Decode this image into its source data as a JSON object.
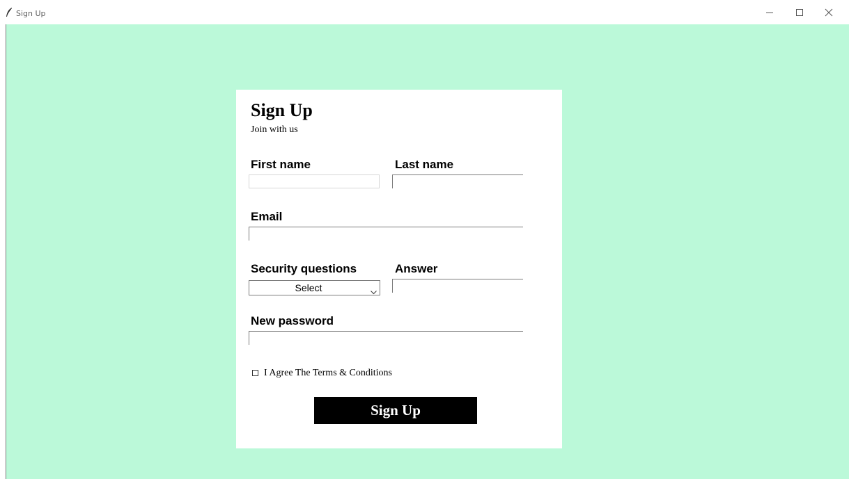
{
  "window": {
    "title": "Sign Up"
  },
  "form": {
    "title": "Sign Up",
    "subtitle": "Join with us",
    "first_name_label": "First name",
    "first_name_value": "",
    "last_name_label": "Last name",
    "last_name_value": "",
    "email_label": "Email",
    "email_value": "",
    "security_label": "Security questions",
    "security_selected": "Select",
    "answer_label": "Answer",
    "answer_value": "",
    "password_label": "New password",
    "password_value": "",
    "terms_label": "I Agree The Terms & Conditions",
    "terms_checked": false,
    "submit_label": "Sign Up"
  },
  "colors": {
    "background": "#bbf9d9",
    "card": "#ffffff",
    "button": "#000000",
    "button_text": "#ffffff"
  }
}
